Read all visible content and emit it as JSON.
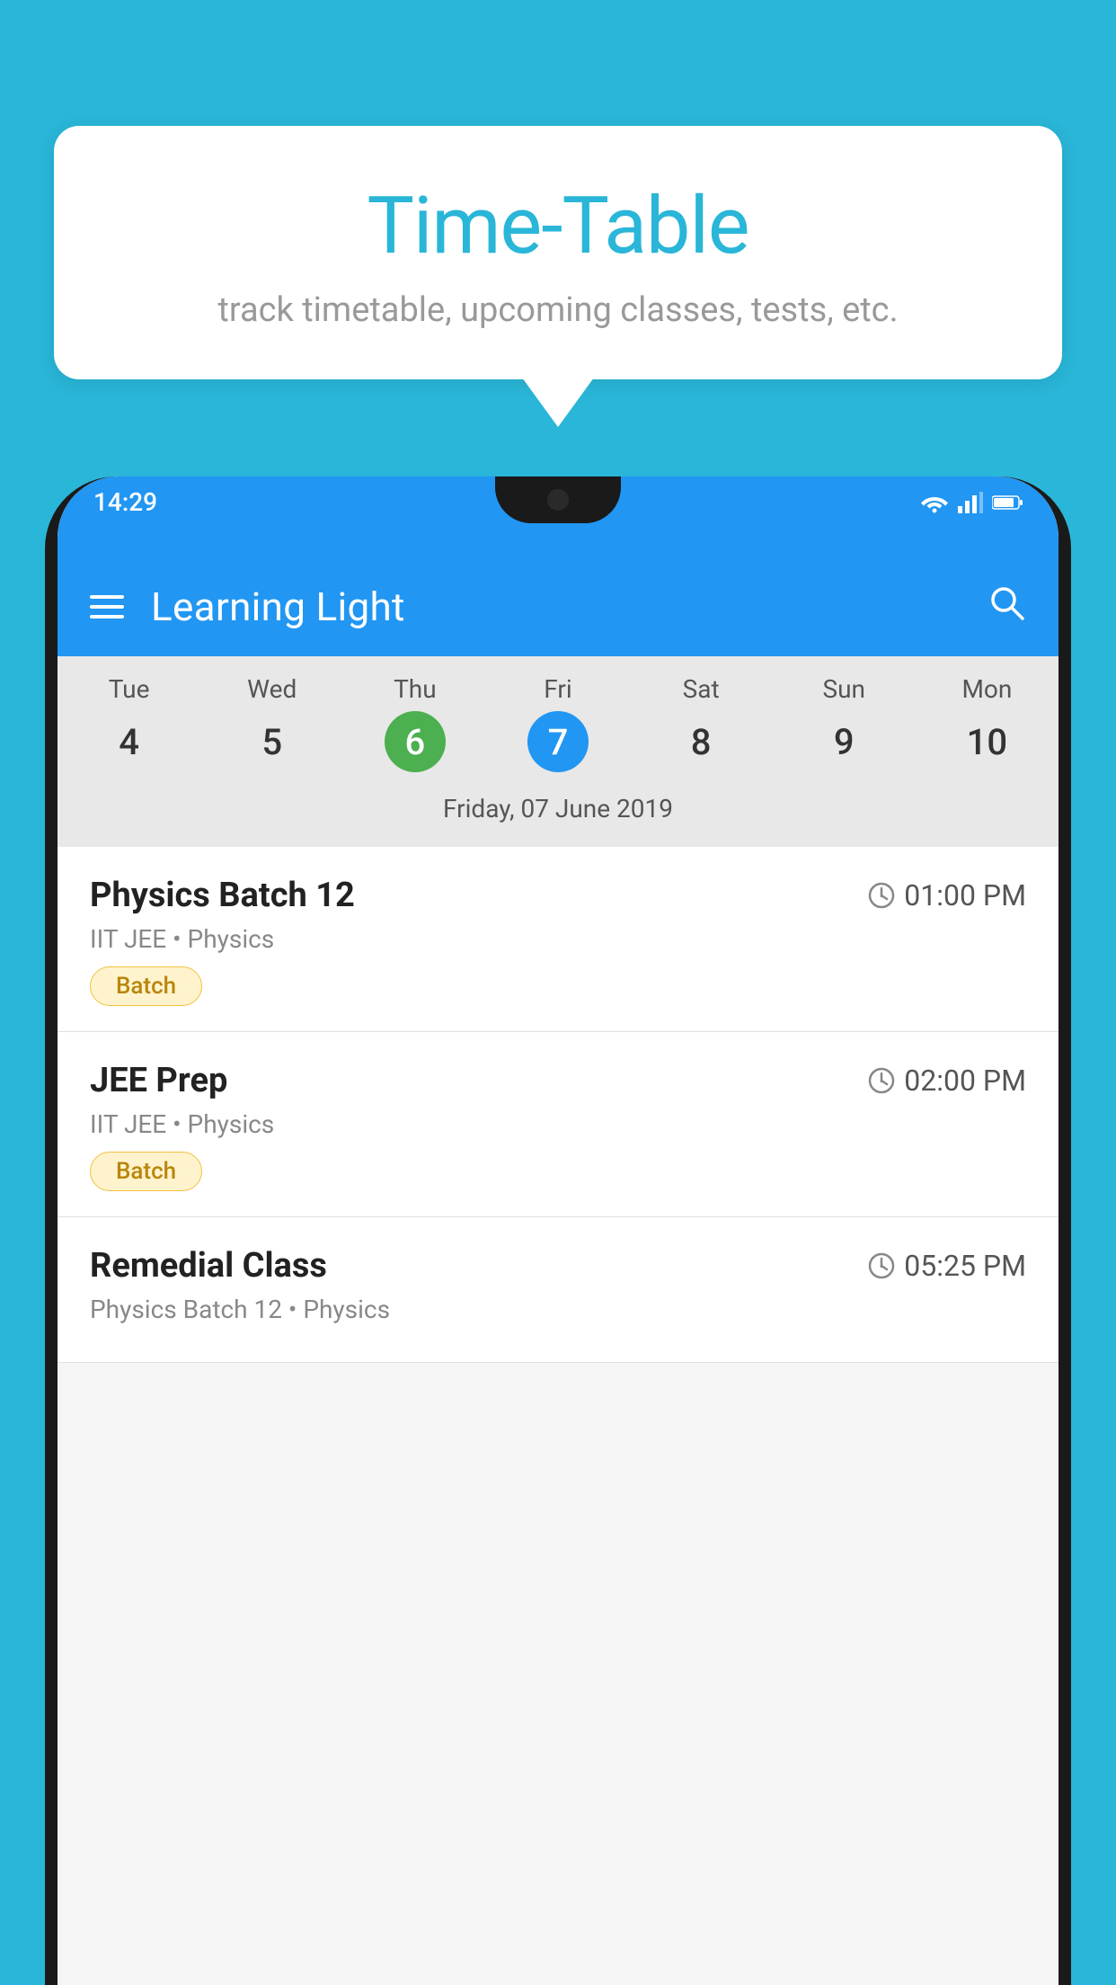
{
  "background_color": "#29b6d8",
  "speech_bubble": {
    "title": "Time-Table",
    "subtitle": "track timetable, upcoming classes, tests, etc."
  },
  "phone": {
    "status_bar": {
      "time": "14:29",
      "icons": [
        "wifi",
        "signal",
        "battery"
      ]
    },
    "app_bar": {
      "title": "Learning Light"
    },
    "calendar": {
      "days": [
        {
          "name": "Tue",
          "number": "4"
        },
        {
          "name": "Wed",
          "number": "5"
        },
        {
          "name": "Thu",
          "number": "6",
          "state": "today"
        },
        {
          "name": "Fri",
          "number": "7",
          "state": "selected"
        },
        {
          "name": "Sat",
          "number": "8"
        },
        {
          "name": "Sun",
          "number": "9"
        },
        {
          "name": "Mon",
          "number": "10"
        }
      ],
      "selected_date": "Friday, 07 June 2019"
    },
    "schedule": [
      {
        "title": "Physics Batch 12",
        "time": "01:00 PM",
        "subtitle": "IIT JEE • Physics",
        "tag": "Batch"
      },
      {
        "title": "JEE Prep",
        "time": "02:00 PM",
        "subtitle": "IIT JEE • Physics",
        "tag": "Batch"
      },
      {
        "title": "Remedial Class",
        "time": "05:25 PM",
        "subtitle": "Physics Batch 12 • Physics",
        "tag": null
      }
    ]
  }
}
